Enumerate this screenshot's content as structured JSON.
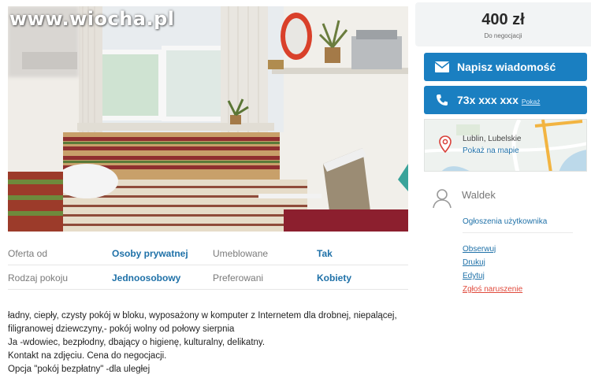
{
  "watermark": "www.wiocha.pl",
  "price": {
    "amount": "400 zł",
    "note": "Do negocjacji"
  },
  "buttons": {
    "message_label": "Napisz wiadomość",
    "phone_number": "73x xxx xxx",
    "phone_show": "Pokaż"
  },
  "location": {
    "city": "Lublin, Lubelskie",
    "map_link": "Pokaż na mapie"
  },
  "user": {
    "name": "Waldek",
    "ads_link": "Ogłoszenia użytkownika",
    "actions": [
      "Obserwuj",
      "Drukuj",
      "Edytuj",
      "Zgłoś naruszenie"
    ]
  },
  "details": [
    {
      "label1": "Oferta od",
      "value1": "Osoby prywatnej",
      "label2": "Umeblowane",
      "value2": "Tak"
    },
    {
      "label1": "Rodzaj pokoju",
      "value1": "Jednoosobowy",
      "label2": "Preferowani",
      "value2": "Kobiety"
    }
  ],
  "description": [
    "ładny, ciepły, czysty pokój w bloku, wyposażony w komputer z Internetem dla drobnej, niepalącej,",
    "filigranowej dziewczyny,- pokój wolny od połowy sierpnia",
    "Ja -wdowiec, bezpłodny, dbający o higienę, kulturalny, delikatny.",
    "Kontakt na zdjęciu. Cena do negocjacji.",
    "Opcja \"pokój bezpłatny\" -dla uległej"
  ],
  "colors": {
    "accent": "#1a7fc1",
    "link": "#1f71a8",
    "report": "#e04a3c"
  }
}
